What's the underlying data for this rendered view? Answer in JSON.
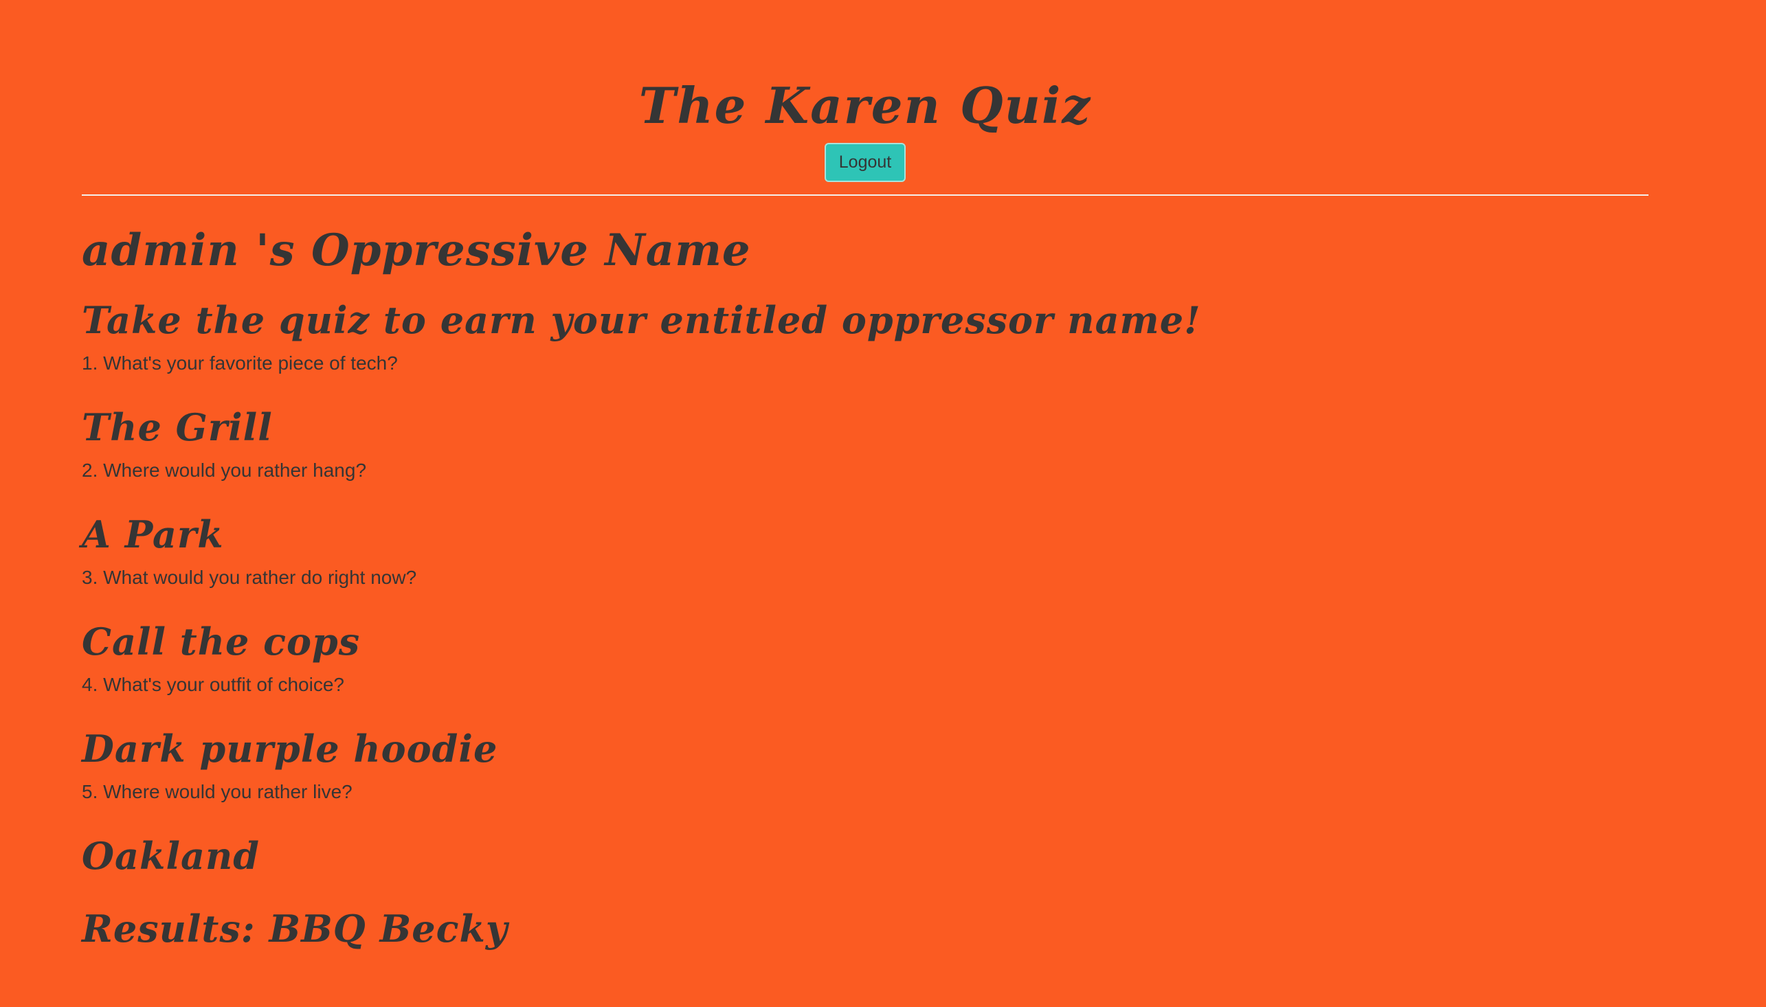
{
  "header": {
    "title": "The Karen Quiz",
    "logout_label": "Logout"
  },
  "main": {
    "heading": "admin 's Oppressive Name",
    "subtitle": "Take the quiz to earn your entitled oppressor name!",
    "questions": [
      {
        "question": "1. What's your favorite piece of tech?",
        "answer": "The Grill"
      },
      {
        "question": "2. Where would you rather hang?",
        "answer": "A Park"
      },
      {
        "question": "3. What would you rather do right now?",
        "answer": "Call the cops"
      },
      {
        "question": "4. What's your outfit of choice?",
        "answer": "Dark purple hoodie"
      },
      {
        "question": "5. Where would you rather live?",
        "answer": "Oakland"
      }
    ],
    "result": "Results: BBQ Becky"
  },
  "colors": {
    "background": "#fb5b22",
    "text": "#353535",
    "button": "#2ec4b6",
    "divider": "#f4f0ec"
  }
}
